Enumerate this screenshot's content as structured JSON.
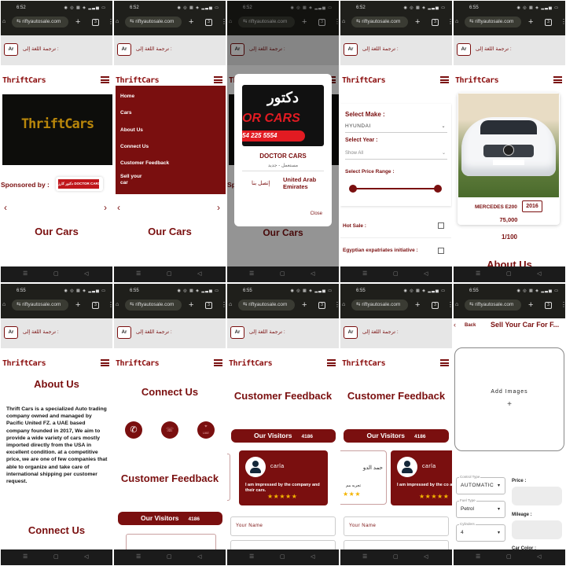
{
  "browser": {
    "url": "riftyautosale.com",
    "times": [
      "6:52",
      "6:52",
      "6:52",
      "6:52",
      "6:55",
      "6:55",
      "6:55",
      "6:55",
      "6:55",
      "6:55"
    ]
  },
  "translate": {
    "label": "ترجمة اللغة إلى :",
    "button": "Ar"
  },
  "brand": {
    "logo": "ThriftCars",
    "accent": "#7a0f0f"
  },
  "screen1": {
    "hero_text": "ThriftCars",
    "sponsored_label": "Sponsored by :",
    "sponsor_name": "دكتور كارز DOCTOR CARS",
    "prev": "‹",
    "next": "›",
    "section_title": "Our Cars"
  },
  "screen2": {
    "menu": [
      {
        "label": "Home"
      },
      {
        "label": "Cars"
      },
      {
        "label": "About Us"
      },
      {
        "label": "Connect Us"
      },
      {
        "label": "Customer Feedback"
      },
      {
        "label": "Sell your car"
      }
    ],
    "section_title": "Our Cars"
  },
  "screen3": {
    "modal": {
      "logo_arabic": "دكتور",
      "logo_english": "OR CARS",
      "logo_phone": "54 225 5554",
      "title": "DOCTOR CARS",
      "subtitle": "مستعمل - جديد",
      "contact": "إتصل بنا",
      "location": "United Arab Emirates",
      "close": "Close"
    },
    "section_title": "Our Cars"
  },
  "screen4": {
    "make_label": "Select Make :",
    "make_value": "HYUNDAI",
    "year_label": "Select Year :",
    "year_value": "Show All",
    "price_label": "Select Price Range :",
    "price_range": {
      "min_fraction": 0,
      "max_fraction": 1
    },
    "hot_sale_label": "Hot Sale :",
    "hot_sale_checked": false,
    "expat_label": "Egyptian expatriates initiative :",
    "expat_checked": false
  },
  "screen5": {
    "car_name": "MERCEDES E200",
    "car_year": "2016",
    "car_price": "75,000",
    "pager": "1/100",
    "next_section": "About Us"
  },
  "screen6": {
    "title": "About Us",
    "body": "Thrift Cars is a specialized Auto trading company owned and managed by Pacific United FZ. a UAE based company founded in 2017, We aim to provide a wide variety of cars mostly imported directly from the USA in excellent condition. at a competitive price, we are one of few companies that able to organize and take care of international shipping per customer request.",
    "next_section": "Connect Us"
  },
  "screen7": {
    "title": "Connect Us",
    "icons": [
      "whatsapp-icon",
      "phone-icon",
      "location-icon"
    ],
    "location_caption": "UAE",
    "feedback_title": "Customer Feedback",
    "visitors_label": "Our Visitors",
    "visitors_count": "4186"
  },
  "screen8": {
    "title": "Customer Feedback",
    "visitors_label": "Our Visitors",
    "visitors_count": "4186",
    "review": {
      "name": "carla",
      "text": "I am impressed by the company and their cars.",
      "stars": "★★★★★"
    },
    "name_placeholder": "Your Name"
  },
  "screen9": {
    "title": "Customer Feedback",
    "visitors_label": "Our Visitors",
    "visitors_count": "4186",
    "prev_review": {
      "name": "حمد الدو",
      "text": "تجربه مم",
      "stars": "★★★"
    },
    "review": {
      "name": "carla",
      "text": "I am impressed by the co and their cars.",
      "stars": "★★★★★"
    },
    "name_placeholder": "Your Name"
  },
  "screen10": {
    "back": "Back",
    "title": "Sell Your Car For F...",
    "add_images": "Add Images",
    "add_plus": "+",
    "control_type_label": "Control Type",
    "control_type": "AUTOMATIC",
    "fuel_type_label": "Fuel Type",
    "fuel_type": "Petrol",
    "cylinders_label": "Cylinders",
    "cylinders": "4",
    "price_label": "Price :",
    "mileage_label": "Mileage :",
    "car_color_label": "Car Color :"
  },
  "navbar": {
    "recent": "☰",
    "home": "▢",
    "back": "◁"
  }
}
